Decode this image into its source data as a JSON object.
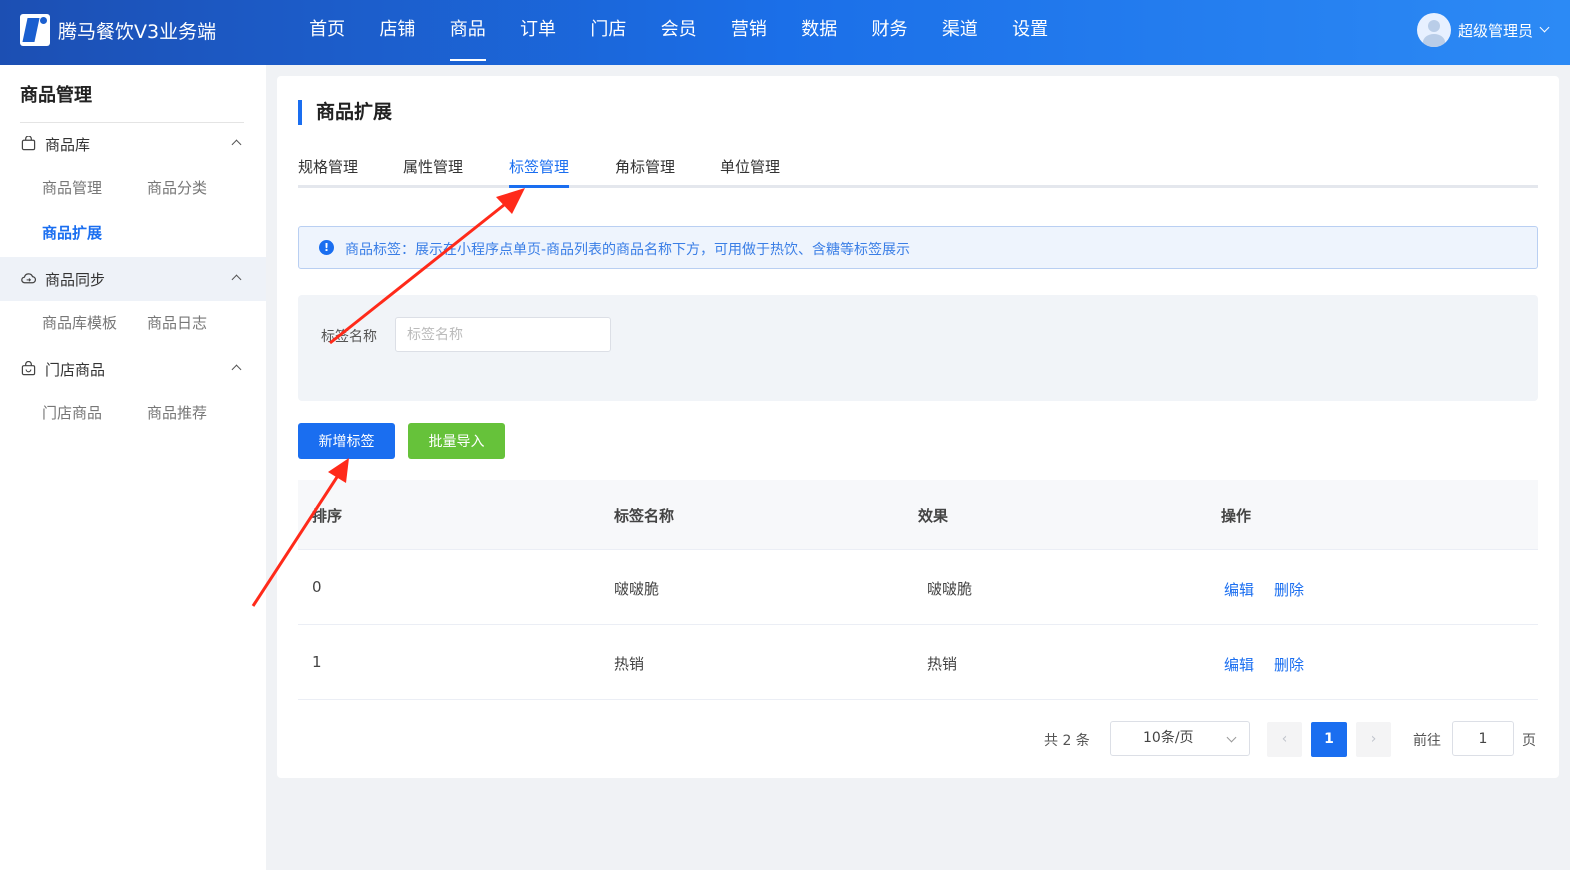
{
  "app": {
    "name": "腾马餐饮V3业务端"
  },
  "topnav": [
    "首页",
    "店铺",
    "商品",
    "订单",
    "门店",
    "会员",
    "营销",
    "数据",
    "财务",
    "渠道",
    "设置"
  ],
  "topnav_active": "商品",
  "user": {
    "name": "超级管理员"
  },
  "sidebar": {
    "title": "商品管理",
    "groups": [
      {
        "label": "商品库",
        "icon": "bag-icon",
        "items": [
          "商品管理",
          "商品分类",
          "商品扩展"
        ]
      },
      {
        "label": "商品同步",
        "icon": "cloud-sync-icon",
        "items": [
          "商品库模板",
          "商品日志"
        ]
      },
      {
        "label": "门店商品",
        "icon": "shop-bag-icon",
        "items": [
          "门店商品",
          "商品推荐"
        ]
      }
    ],
    "active_item": "商品扩展"
  },
  "page": {
    "title": "商品扩展",
    "tabs": [
      "规格管理",
      "属性管理",
      "标签管理",
      "角标管理",
      "单位管理"
    ],
    "active_tab": "标签管理",
    "notice": "商品标签：展示在小程序点单页-商品列表的商品名称下方，可用做于热饮、含糖等标签展示",
    "filter": {
      "label": "标签名称",
      "placeholder": "标签名称",
      "value": ""
    },
    "buttons": {
      "add": "新增标签",
      "import": "批量导入"
    },
    "table": {
      "headers": [
        "排序",
        "标签名称",
        "效果",
        "操作"
      ],
      "rows": [
        {
          "sort": "0",
          "name": "啵啵脆",
          "effect": "啵啵脆"
        },
        {
          "sort": "1",
          "name": "热销",
          "effect": "热销"
        }
      ],
      "actions": {
        "edit": "编辑",
        "delete": "删除"
      }
    },
    "pagination": {
      "total": "共 2 条",
      "page_size": "10条/页",
      "current": "1",
      "goto_label": "前往",
      "goto_value": "1",
      "page_unit": "页"
    }
  },
  "colors": {
    "accent": "#1a6ef0",
    "success": "#66c23a",
    "annotation": "#ff2a1a"
  }
}
